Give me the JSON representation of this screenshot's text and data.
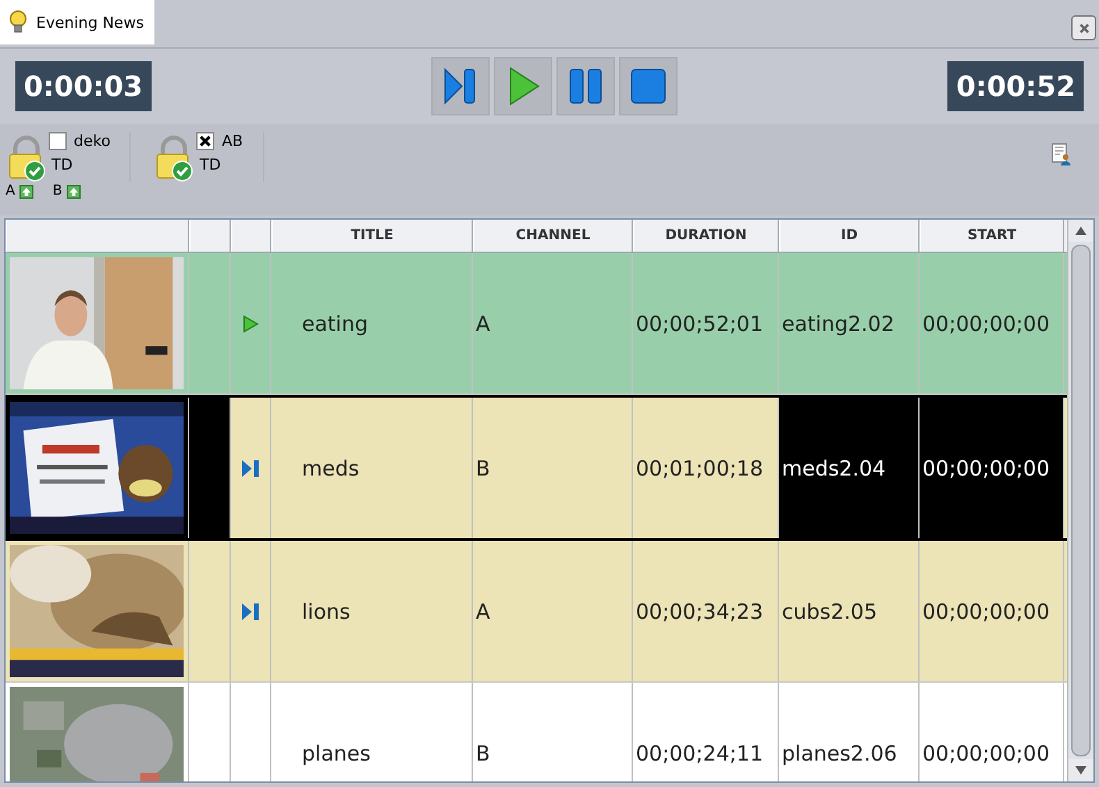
{
  "tab": {
    "label": "Evening News",
    "selected": true
  },
  "timers": {
    "elapsed": "0:00:03",
    "remaining": "0:00:52"
  },
  "transport": [
    {
      "kind": "next"
    },
    {
      "kind": "play"
    },
    {
      "kind": "pause"
    },
    {
      "kind": "stop"
    }
  ],
  "locks": [
    {
      "label": "deko",
      "checked": false,
      "sub": "TD"
    },
    {
      "label": "AB",
      "checked": true,
      "sub": "TD"
    }
  ],
  "channels": [
    "A",
    "B"
  ],
  "table": {
    "columns": [
      "",
      "",
      "",
      "TITLE",
      "CHANNEL",
      "DURATION",
      "ID",
      "START"
    ],
    "rows": [
      {
        "kind": "playing",
        "selected": false,
        "title": "eating",
        "channel": "A",
        "duration": "00;00;52;01",
        "id": "eating2.02",
        "start": "00;00;00;00"
      },
      {
        "kind": "cued",
        "selected": true,
        "title": "meds",
        "channel": "B",
        "duration": "00;01;00;18",
        "id": "meds2.04",
        "start": "00;00;00;00"
      },
      {
        "kind": "cued",
        "selected": false,
        "title": "lions",
        "channel": "A",
        "duration": "00;00;34;23",
        "id": "cubs2.05",
        "start": "00;00;00;00"
      },
      {
        "kind": "none",
        "selected": false,
        "title": "planes",
        "channel": "B",
        "duration": "00;00;24;11",
        "id": "planes2.06",
        "start": "00;00;00;00"
      }
    ]
  }
}
